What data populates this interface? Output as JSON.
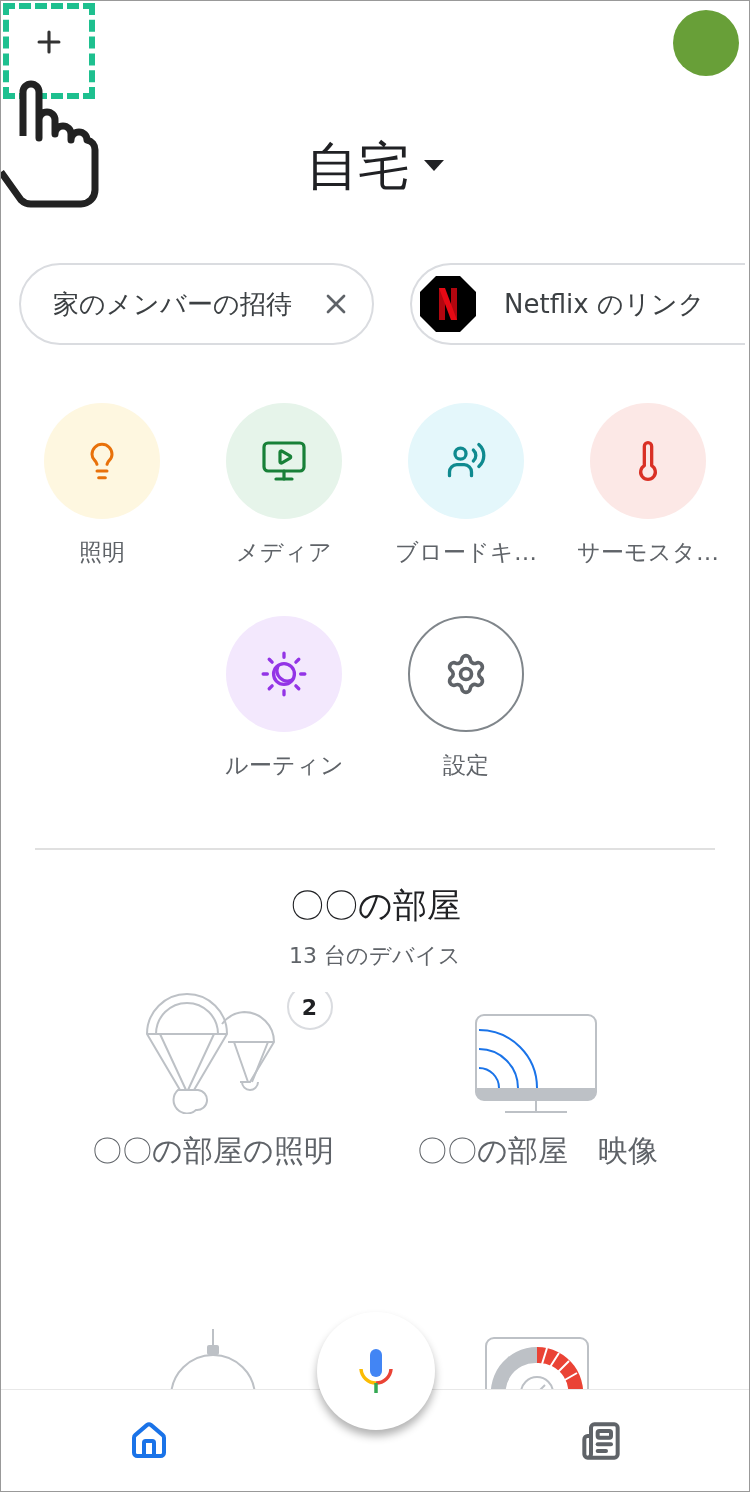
{
  "header": {
    "home_name": "自宅"
  },
  "chips": [
    {
      "kind": "invite",
      "label": "家のメンバーの招待"
    },
    {
      "kind": "link",
      "label": "Netflix のリンク"
    }
  ],
  "actions": [
    {
      "kind": "lights",
      "label": "照明"
    },
    {
      "kind": "media",
      "label": "メディア"
    },
    {
      "kind": "broadcast",
      "label": "ブロードキ…"
    },
    {
      "kind": "thermostat",
      "label": "サーモスタ…"
    },
    {
      "kind": "routines",
      "label": "ルーティン"
    },
    {
      "kind": "settings",
      "label": "設定"
    }
  ],
  "room": {
    "name": "〇〇の部屋",
    "device_count": "13 台のデバイス",
    "devices": [
      {
        "kind": "lights",
        "label": "〇〇の部屋の照明",
        "badge": "2"
      },
      {
        "kind": "display",
        "label": "〇〇の部屋　映像"
      },
      {
        "kind": "speaker"
      },
      {
        "kind": "thermostat"
      }
    ]
  },
  "nav": [
    {
      "kind": "home",
      "selected": true
    },
    {
      "kind": "feed",
      "selected": false
    }
  ]
}
